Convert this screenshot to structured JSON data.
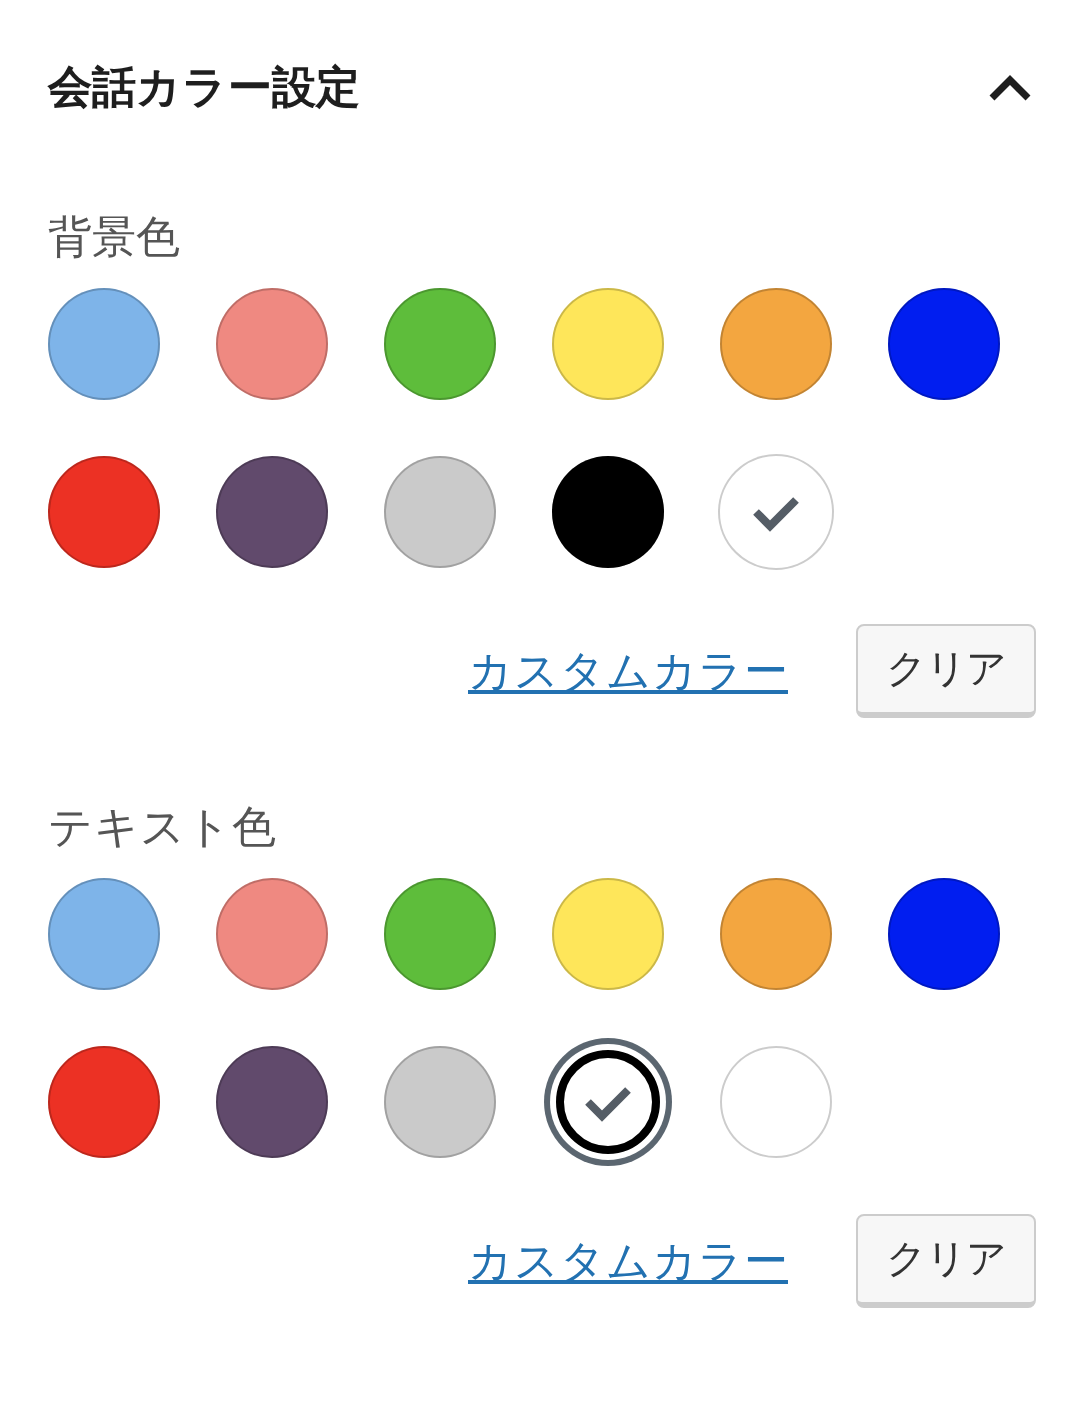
{
  "panel": {
    "title": "会話カラー設定",
    "expanded": true
  },
  "sections": [
    {
      "label": "背景色",
      "focused": false,
      "custom_link": "カスタムカラー",
      "clear_button": "クリア",
      "swatches": [
        {
          "color": "#7eb4e9",
          "selected": false
        },
        {
          "color": "#ef8981",
          "selected": false
        },
        {
          "color": "#5ebd3b",
          "selected": false
        },
        {
          "color": "#fee65a",
          "selected": false
        },
        {
          "color": "#f3a640",
          "selected": false
        },
        {
          "color": "#011ef0",
          "selected": false
        },
        {
          "color": "#ec3124",
          "selected": false
        },
        {
          "color": "#614a6c",
          "selected": false
        },
        {
          "color": "#cacaca",
          "selected": false
        },
        {
          "color": "#000000",
          "selected": false
        },
        {
          "color": "#ffffff",
          "selected": true
        }
      ]
    },
    {
      "label": "テキスト色",
      "focused": true,
      "custom_link": "カスタムカラー",
      "clear_button": "クリア",
      "swatches": [
        {
          "color": "#7eb4e9",
          "selected": false
        },
        {
          "color": "#ef8981",
          "selected": false
        },
        {
          "color": "#5ebd3b",
          "selected": false
        },
        {
          "color": "#fee65a",
          "selected": false
        },
        {
          "color": "#f3a640",
          "selected": false
        },
        {
          "color": "#011ef0",
          "selected": false
        },
        {
          "color": "#ec3124",
          "selected": false
        },
        {
          "color": "#614a6c",
          "selected": false
        },
        {
          "color": "#cacaca",
          "selected": false
        },
        {
          "color": "#000000",
          "selected": true
        },
        {
          "color": "#ffffff",
          "selected": false
        }
      ]
    }
  ]
}
